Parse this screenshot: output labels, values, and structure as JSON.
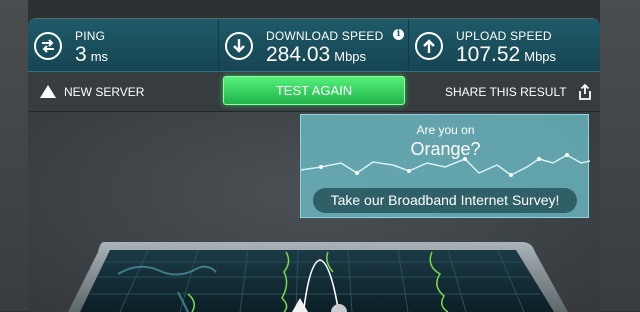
{
  "stats": {
    "ping": {
      "label": "PING",
      "value": "3",
      "unit": "ms",
      "icon": "ping-arrows-icon"
    },
    "download": {
      "label": "DOWNLOAD SPEED",
      "value": "284.03",
      "unit": "Mbps",
      "icon": "download-arrow-icon",
      "info_icon": "info-icon"
    },
    "upload": {
      "label": "UPLOAD SPEED",
      "value": "107.52",
      "unit": "Mbps",
      "icon": "upload-arrow-icon"
    }
  },
  "actions": {
    "new_server_label": "NEW SERVER",
    "test_again_label": "TEST AGAIN",
    "share_label": "SHARE THIS RESULT",
    "new_server_icon": "triangle-icon",
    "share_icon": "share-icon"
  },
  "survey": {
    "question": "Are you on",
    "isp": "Orange?",
    "button_label": "Take our Broadband Internet Survey!"
  },
  "colors": {
    "accent_teal": "#1e5a68",
    "test_button_green": "#2bc354",
    "map_border_green": "#7cd64a",
    "survey_panel": "#6cbec8"
  }
}
